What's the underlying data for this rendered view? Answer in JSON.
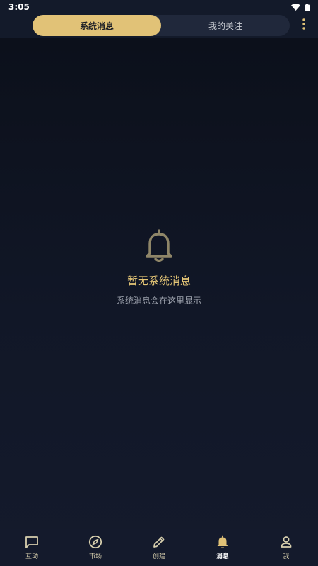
{
  "status_bar": {
    "time": "3:05"
  },
  "header": {
    "tabs": [
      {
        "label": "系统消息",
        "active": true
      },
      {
        "label": "我的关注",
        "active": false
      }
    ]
  },
  "empty_state": {
    "title": "暂无系统消息",
    "subtitle": "系统消息会在这里显示"
  },
  "bottom_nav": {
    "items": [
      {
        "label": "互动",
        "icon": "chat-icon",
        "active": false
      },
      {
        "label": "市场",
        "icon": "compass-icon",
        "active": false
      },
      {
        "label": "创建",
        "icon": "pencil-icon",
        "active": false
      },
      {
        "label": "消息",
        "icon": "bell-icon",
        "active": true
      },
      {
        "label": "我",
        "icon": "person-icon",
        "active": false
      }
    ]
  },
  "colors": {
    "accent": "#e1c277",
    "background": "#0d111b",
    "segment_bg": "#20283b"
  }
}
